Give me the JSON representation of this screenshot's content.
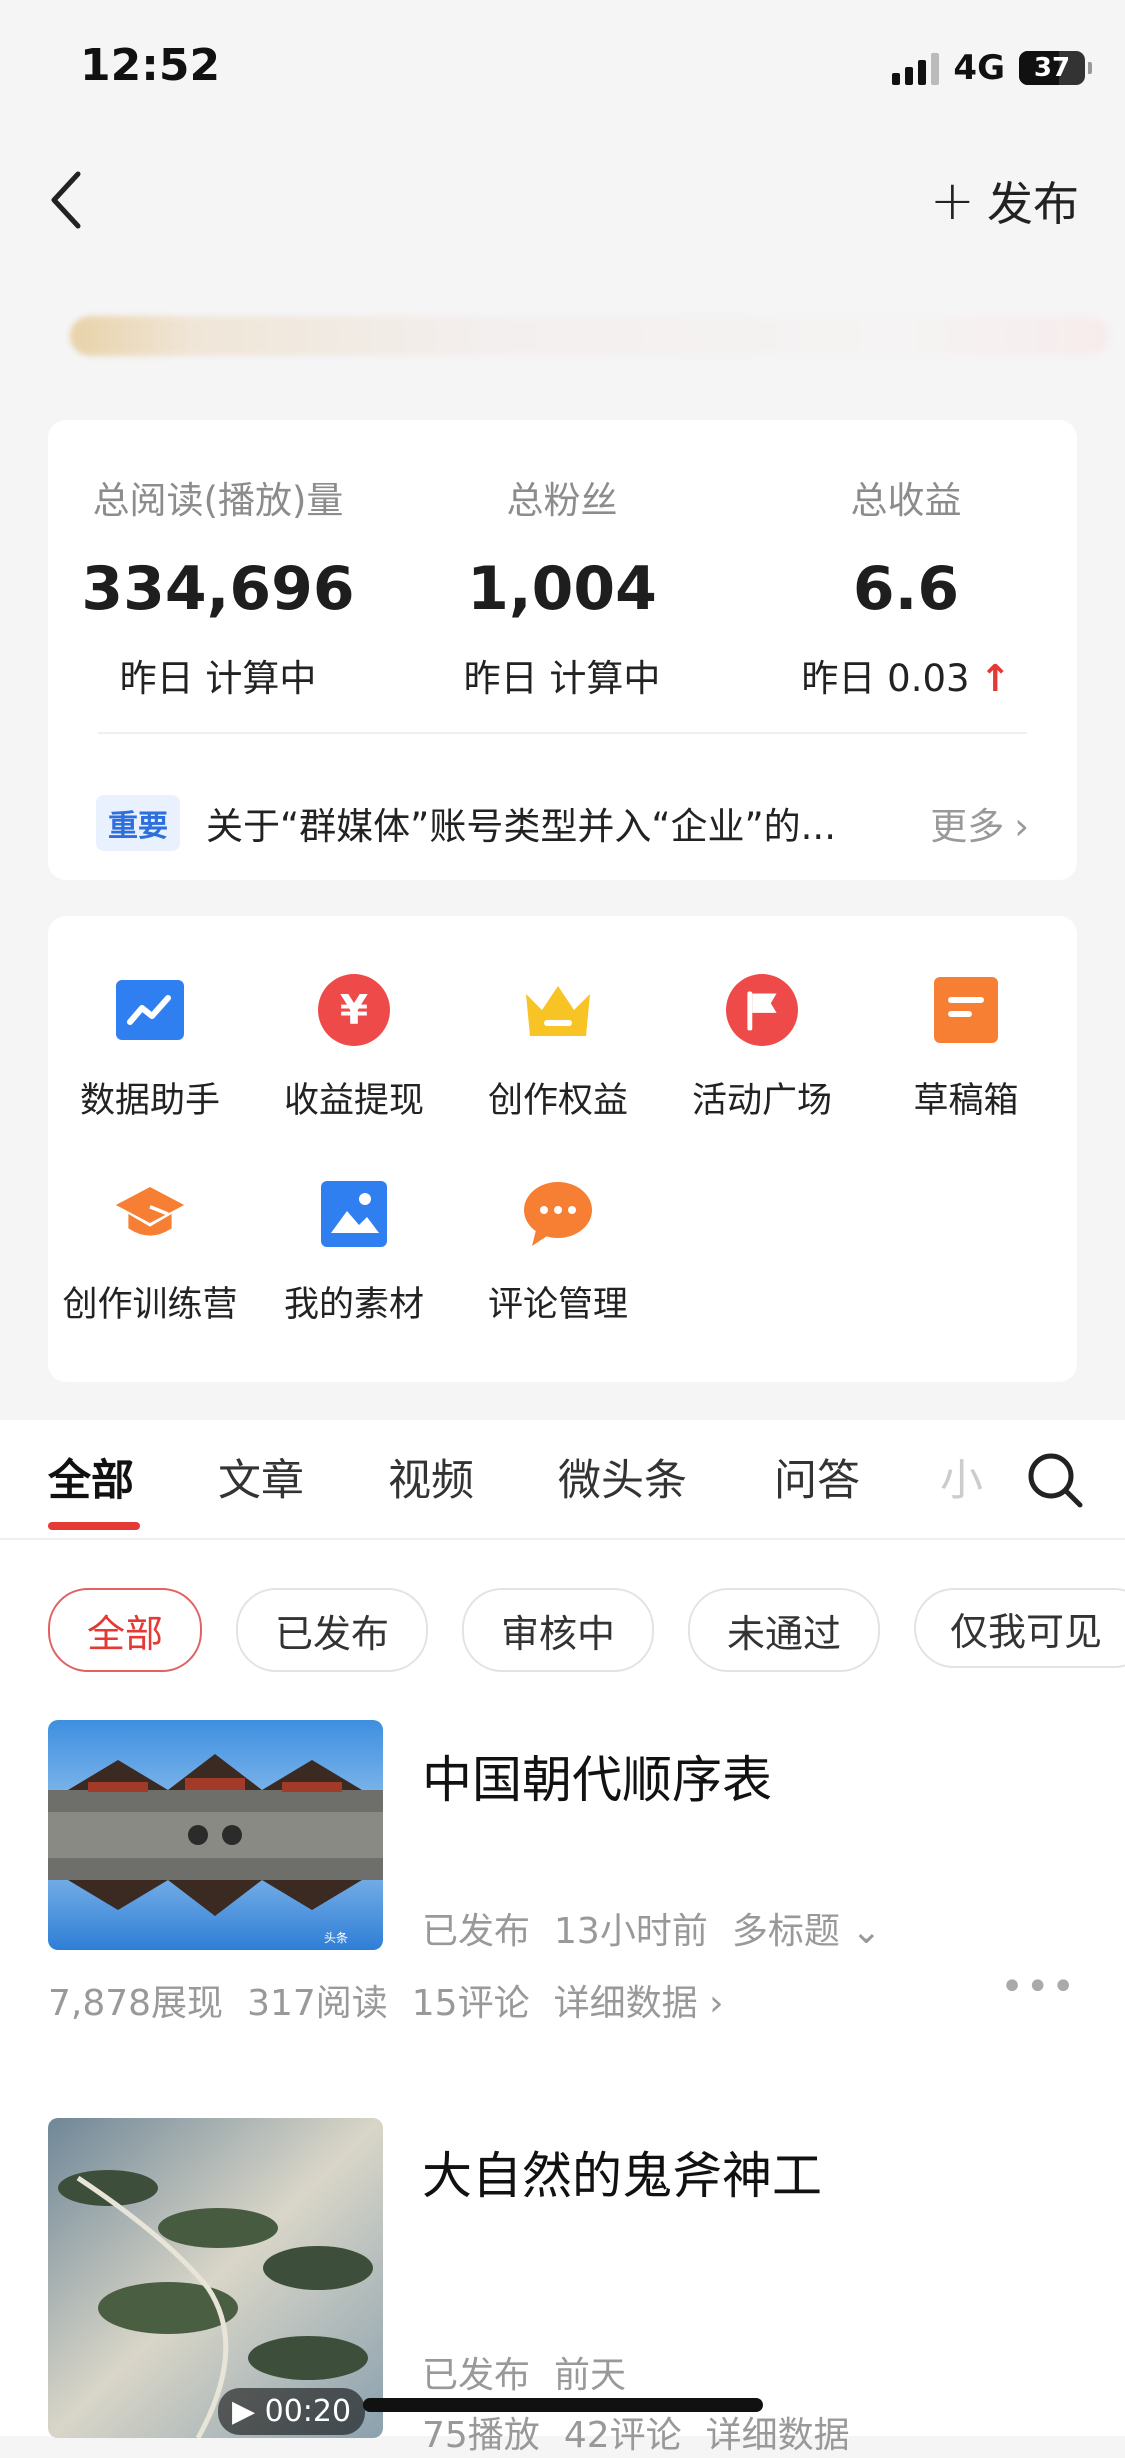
{
  "status_bar": {
    "time": "12:52",
    "network": "4G",
    "battery": "37"
  },
  "header": {
    "publish_label": "发布"
  },
  "stats": [
    {
      "label": "总阅读(播放)量",
      "value": "334,696",
      "sub": "昨日 计算中"
    },
    {
      "label": "总粉丝",
      "value": "1,004",
      "sub": "昨日 计算中"
    },
    {
      "label": "总收益",
      "value": "6.6",
      "sub": "昨日 0.03",
      "trend": "up"
    }
  ],
  "notice": {
    "tag": "重要",
    "text": "关于“群媒体”账号类型并入“企业”的...",
    "more": "更多"
  },
  "tools": [
    {
      "label": "数据助手",
      "icon": "chart-icon",
      "color": "#2f7ff0"
    },
    {
      "label": "收益提现",
      "icon": "yuan-icon",
      "color": "#ef4a4a"
    },
    {
      "label": "创作权益",
      "icon": "crown-icon",
      "color": "#f7c325"
    },
    {
      "label": "活动广场",
      "icon": "flag-icon",
      "color": "#ef4a4a"
    },
    {
      "label": "草稿箱",
      "icon": "draft-icon",
      "color": "#f77f34"
    },
    {
      "label": "创作训练营",
      "icon": "graduation-cap-icon",
      "color": "#f77f34"
    },
    {
      "label": "我的素材",
      "icon": "image-icon",
      "color": "#2f7ff0"
    },
    {
      "label": "评论管理",
      "icon": "comment-icon",
      "color": "#f77f34"
    }
  ],
  "tabs": [
    "全部",
    "文章",
    "视频",
    "微头条",
    "问答",
    "小"
  ],
  "filters": [
    "全部",
    "已发布",
    "审核中",
    "未通过",
    "仅我可见"
  ],
  "articles": [
    {
      "title": "中国朝代顺序表",
      "status": "已发布",
      "time": "13小时前",
      "extra": "多标题",
      "stats": [
        "7,878展现",
        "317阅读",
        "15评论"
      ],
      "detail": "详细数据",
      "thumb_watermark": "头条"
    },
    {
      "title": "大自然的鬼斧神工",
      "status": "已发布",
      "time": "前天",
      "duration": "00:20",
      "stats": [
        "75播放",
        "42评论"
      ],
      "detail": "详细数据"
    }
  ]
}
